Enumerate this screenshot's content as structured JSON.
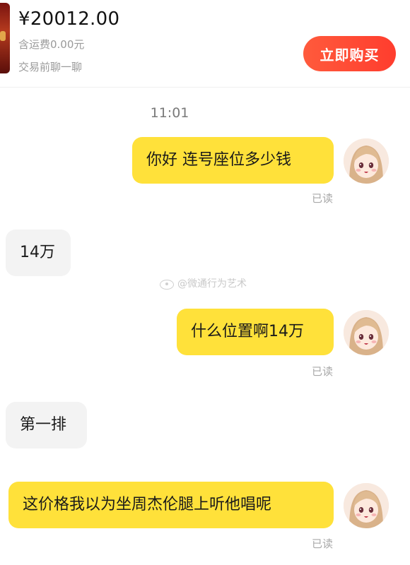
{
  "product": {
    "price": "¥20012.00",
    "shipping": "含运费0.00元",
    "chat_hint": "交易前聊一聊",
    "buy_label": "立即购买"
  },
  "chat": {
    "timestamp": "11:01",
    "watermark": "@微通行为艺术",
    "read_label": "已读",
    "messages": [
      {
        "from": "me",
        "text": "你好 连号座位多少钱"
      },
      {
        "from": "them",
        "text": "14万"
      },
      {
        "from": "me",
        "text": "什么位置啊14万"
      },
      {
        "from": "them",
        "text": "第一排"
      },
      {
        "from": "me",
        "text": "这价格我以为坐周杰伦腿上听他唱呢"
      }
    ]
  },
  "colors": {
    "buy_button": "#ff4a33",
    "my_bubble": "#ffe13a",
    "their_bubble": "#f3f3f3"
  }
}
